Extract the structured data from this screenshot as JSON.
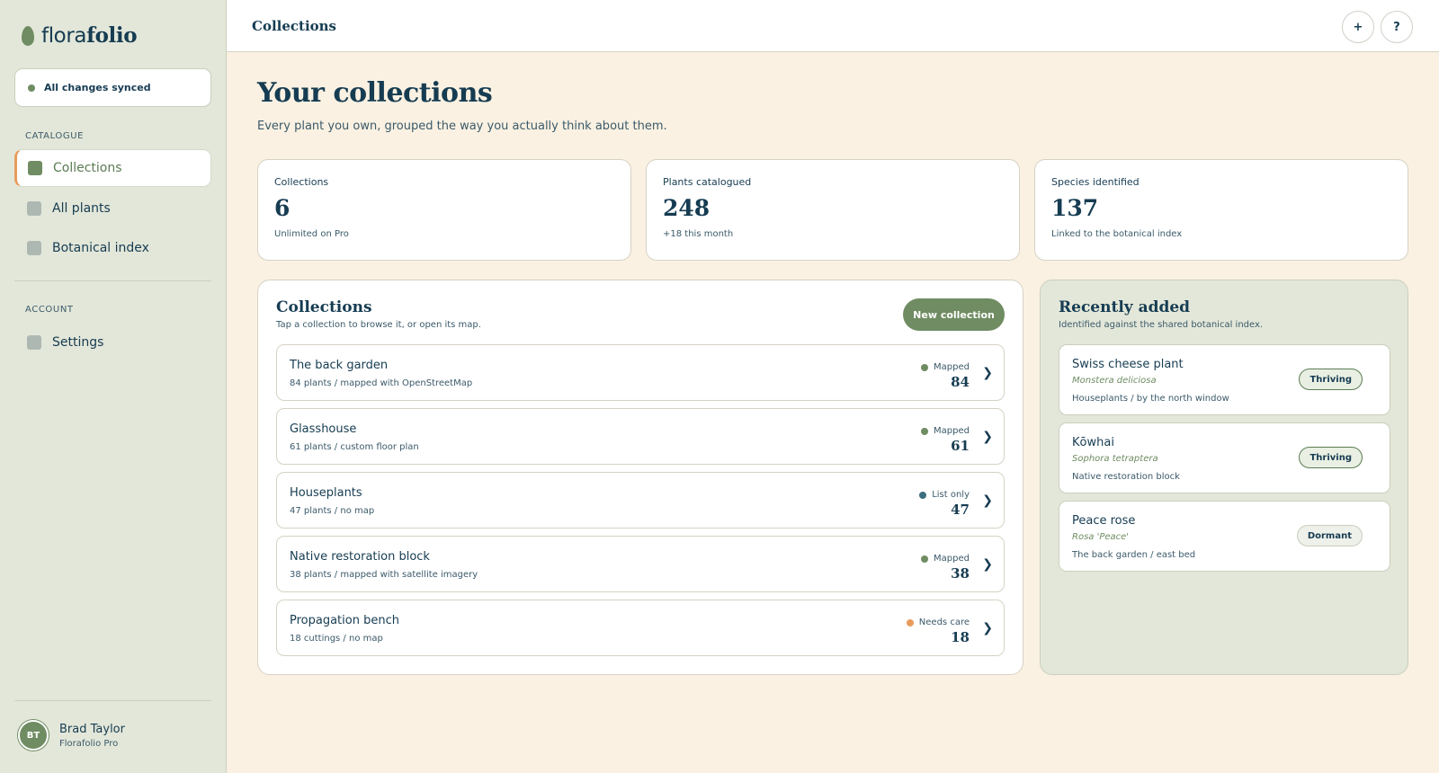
{
  "brand": {
    "prefix": "flora",
    "suffix": "folio"
  },
  "sync": {
    "label": "All changes synced",
    "color": "#6f8c62"
  },
  "sidebar": {
    "catalogue_label": "CATALOGUE",
    "catalogue_items": [
      {
        "label": "Collections",
        "active": true
      },
      {
        "label": "All plants",
        "active": false
      },
      {
        "label": "Botanical index",
        "active": false
      }
    ],
    "account_label": "ACCOUNT",
    "account_items": [
      {
        "label": "Settings",
        "active": false
      }
    ]
  },
  "user": {
    "initials": "BT",
    "name": "Brad Taylor",
    "plan": "Florafolio Pro"
  },
  "header": {
    "title": "Collections",
    "add_label": "+",
    "help_label": "?"
  },
  "main": {
    "title": "Your collections",
    "subtitle": "Every plant you own, grouped the way you actually think about them."
  },
  "stats": [
    {
      "label": "Collections",
      "value": "6",
      "note": "Unlimited on Pro"
    },
    {
      "label": "Plants catalogued",
      "value": "248",
      "note": "+18 this month"
    },
    {
      "label": "Species identified",
      "value": "137",
      "note": "Linked to the botanical index"
    }
  ],
  "collections_panel": {
    "title": "Collections",
    "subtitle": "Tap a collection to browse it, or open its map.",
    "new_button": "New collection",
    "rows": [
      {
        "name": "The back garden",
        "meta": "84 plants / mapped with OpenStreetMap",
        "status": "Mapped",
        "status_color": "#6f8c62",
        "count": "84"
      },
      {
        "name": "Glasshouse",
        "meta": "61 plants / custom floor plan",
        "status": "Mapped",
        "status_color": "#6f8c62",
        "count": "61"
      },
      {
        "name": "Houseplants",
        "meta": "47 plants / no map",
        "status": "List only",
        "status_color": "#3b6e7e",
        "count": "47"
      },
      {
        "name": "Native restoration block",
        "meta": "38 plants / mapped with satellite imagery",
        "status": "Mapped",
        "status_color": "#6f8c62",
        "count": "38"
      },
      {
        "name": "Propagation bench",
        "meta": "18 cuttings / no map",
        "status": "Needs care",
        "status_color": "#e89c5c",
        "count": "18"
      }
    ]
  },
  "recent_panel": {
    "title": "Recently added",
    "subtitle": "Identified against the shared botanical index.",
    "cards": [
      {
        "name": "Swiss cheese plant",
        "scientific": "Monstera deliciosa",
        "location": "Houseplants / by the north window",
        "badge": "Thriving"
      },
      {
        "name": "Kōwhai",
        "scientific": "Sophora tetraptera",
        "location": "Native restoration block",
        "badge": "Thriving"
      },
      {
        "name": "Peace rose",
        "scientific": "Rosa 'Peace'",
        "location": "The back garden / east bed",
        "badge": "Dormant"
      }
    ]
  }
}
